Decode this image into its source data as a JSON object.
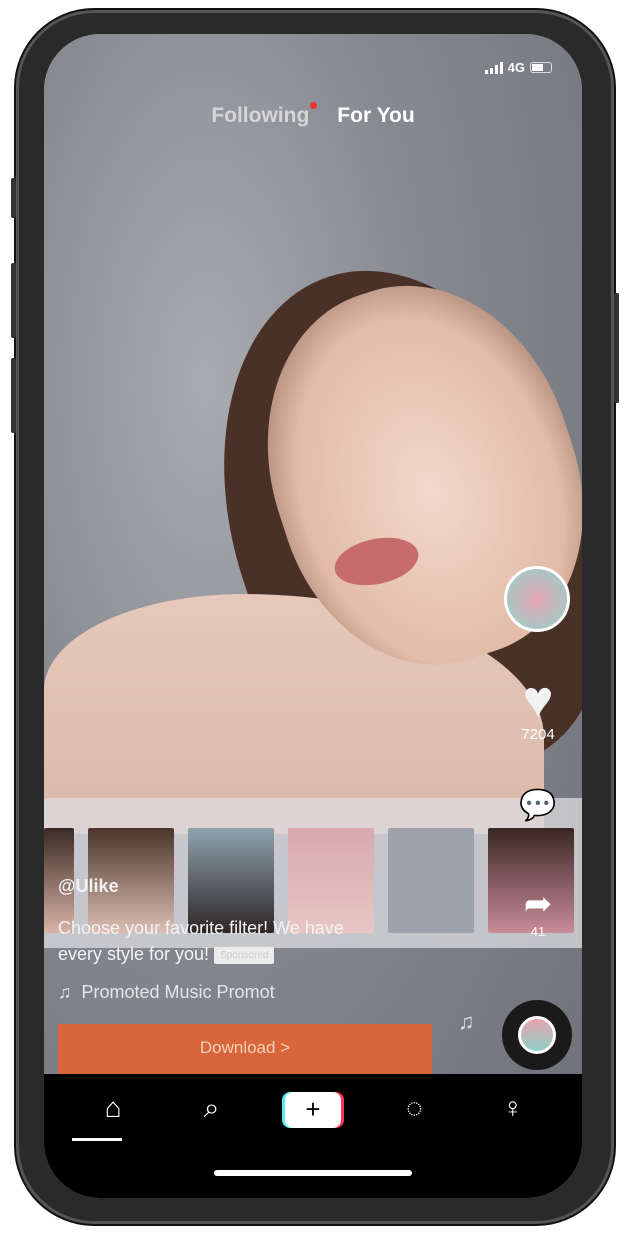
{
  "status_bar": {
    "network": "4G"
  },
  "top_tabs": {
    "following": "Following",
    "for_you": "For You",
    "active": "For You"
  },
  "actions": {
    "likes": "7204",
    "shares": "41"
  },
  "ad": {
    "username": "@Ulike",
    "caption_line1": "Choose your favorite filter! We have",
    "caption_line2": "every style for you!",
    "sponsored": "Sponsored",
    "music": "Promoted Music   Promot",
    "download": "Download >"
  },
  "nav": {
    "items": [
      "home",
      "search",
      "create",
      "inbox",
      "profile"
    ]
  },
  "colors": {
    "download": "#d9663a",
    "notification_dot": "#e33333"
  }
}
